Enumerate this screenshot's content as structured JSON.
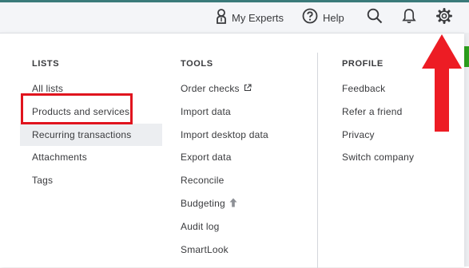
{
  "topbar": {
    "my_experts_label": "My Experts",
    "help_label": "Help",
    "icons": [
      "person-icon",
      "help-circle-icon",
      "search-icon",
      "bell-icon",
      "gear-icon"
    ]
  },
  "menu": {
    "lists": {
      "heading": "LISTS",
      "items": [
        "All lists",
        "Products and services",
        "Recurring transactions",
        "Attachments",
        "Tags"
      ]
    },
    "tools": {
      "heading": "TOOLS",
      "items": [
        "Order checks",
        "Import data",
        "Import desktop data",
        "Export data",
        "Reconcile",
        "Budgeting",
        "Audit log",
        "SmartLook"
      ]
    },
    "profile": {
      "heading": "PROFILE",
      "items": [
        "Feedback",
        "Refer a friend",
        "Privacy",
        "Switch company"
      ]
    }
  },
  "colors": {
    "annotation_red": "#e0141e",
    "highlight_bg": "#eceef1",
    "brand_green": "#2ca01c"
  }
}
